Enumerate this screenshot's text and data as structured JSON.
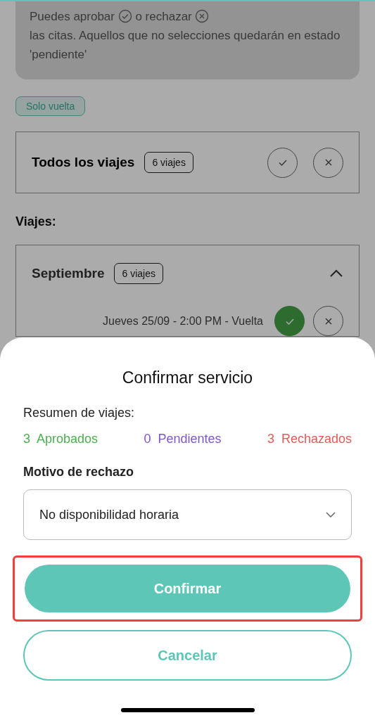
{
  "info": {
    "before": "Puedes aprobar",
    "middle": "o rechazar",
    "after": "las citas. Aquellos que no selecciones quedarán en estado 'pendiente'"
  },
  "filter_chip": {
    "label": "Solo vuelta"
  },
  "all_trips": {
    "title": "Todos los viajes",
    "badge": "6 viajes",
    "approved": false,
    "rejected": false
  },
  "section_title": "Viajes:",
  "month": {
    "title": "Septiembre",
    "badge": "6 viajes",
    "expanded": true,
    "trips": [
      {
        "label": "Jueves 25/09 - 2:00 PM - Vuelta",
        "approved": true,
        "rejected": false
      }
    ]
  },
  "dialog": {
    "title": "Confirmar servicio",
    "summary_label": "Resumen de viajes:",
    "counts": [
      {
        "count": "3",
        "label": "Aprobados",
        "color": "#4caf50"
      },
      {
        "count": "0",
        "label": "Pendientes",
        "color": "#7e57c2"
      },
      {
        "count": "3",
        "label": "Rechazados",
        "color": "#e05c5c"
      }
    ],
    "reason_label": "Motivo de rechazo",
    "reason_value": "No disponibilidad horaria",
    "confirm": {
      "label": "Confirmar",
      "highlighted": true
    },
    "cancel": {
      "label": "Cancelar"
    }
  }
}
